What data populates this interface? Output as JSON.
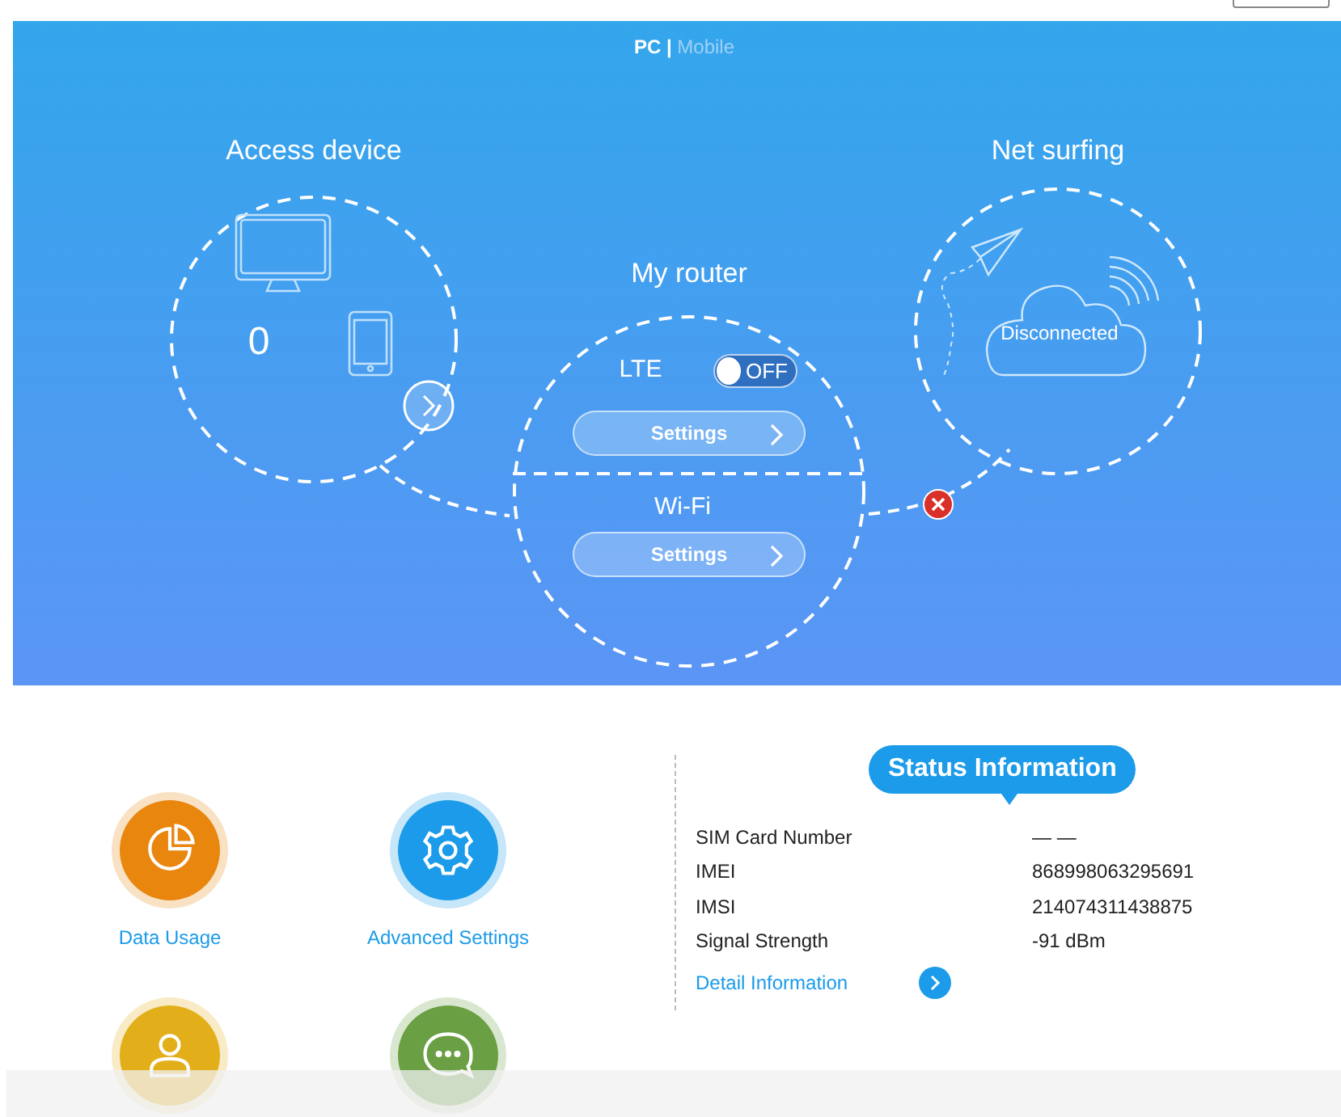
{
  "view_switch": {
    "options": [
      {
        "label": "PC",
        "selected": true
      },
      {
        "label": "Mobile",
        "selected": false
      }
    ],
    "separator": "|"
  },
  "access_device": {
    "title": "Access device",
    "count": "0"
  },
  "router": {
    "title": "My router",
    "lte": {
      "label": "LTE",
      "on": false,
      "toggle_text": "OFF",
      "button": "Settings"
    },
    "wifi": {
      "label": "Wi-Fi",
      "button": "Settings"
    }
  },
  "net_surfing": {
    "title": "Net surfing",
    "status": "Disconnected",
    "connected": false
  },
  "shortcuts": [
    {
      "kind": "usage",
      "label": "Data Usage",
      "color": "#e8860e"
    },
    {
      "kind": "settings",
      "label": "Advanced Settings",
      "color": "#1b9be9"
    },
    {
      "kind": "user",
      "color": "#e2af1b"
    },
    {
      "kind": "messages",
      "color": "#6a9f44"
    }
  ],
  "status": {
    "title": "Status Information",
    "rows": [
      {
        "label": "SIM Card Number",
        "value": "— —"
      },
      {
        "label": "IMEI",
        "value": "868998063295691"
      },
      {
        "label": "IMSI",
        "value": "214074311438875"
      },
      {
        "label": "Signal Strength",
        "value": "-91 dBm"
      }
    ],
    "link": "Detail Information"
  }
}
